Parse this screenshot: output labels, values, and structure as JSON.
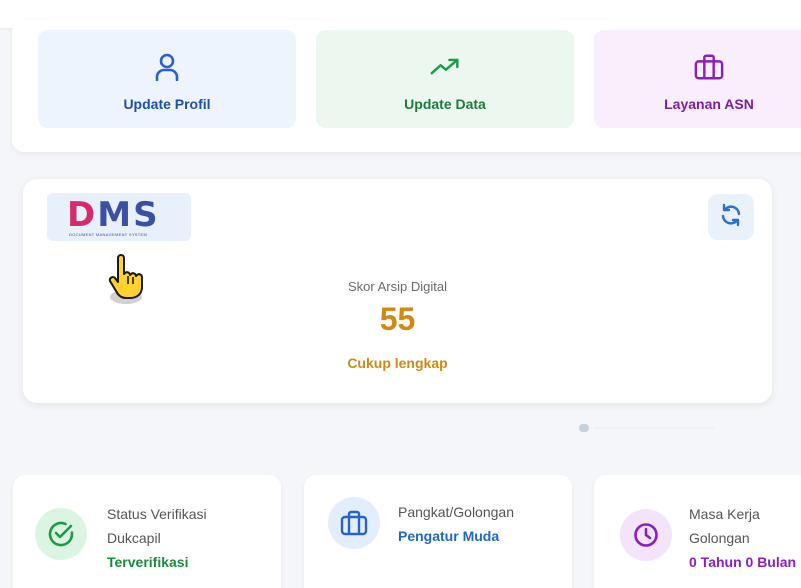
{
  "quick_actions": [
    {
      "label": "Update Profil",
      "icon": "user-icon",
      "color": "#1f4fa8"
    },
    {
      "label": "Update Data",
      "icon": "trending-up-icon",
      "color": "#1f7a3c"
    },
    {
      "label": "Layanan ASN",
      "icon": "briefcase-icon",
      "color": "#7a1fa8"
    }
  ],
  "dms": {
    "logo_d": "D",
    "logo_ms": "MS",
    "logo_sub": "DOCUMENT MANAGEMENT SYSTEM",
    "score_label": "Skor Arsip Digital",
    "score_value": "55",
    "score_status": "Cukup lengkap",
    "accent": "#d08a12"
  },
  "info_cards": [
    {
      "line1": "Status Verifikasi",
      "line2": "Dukcapil",
      "value": "Terverifikasi",
      "icon": "check-circle-icon"
    },
    {
      "line1": "Pangkat/Golongan",
      "value": "Pengatur Muda",
      "icon": "briefcase-icon"
    },
    {
      "line1": "Masa Kerja",
      "line2": "Golongan",
      "value": "0 Tahun 0 Bulan",
      "icon": "clock-icon"
    }
  ]
}
